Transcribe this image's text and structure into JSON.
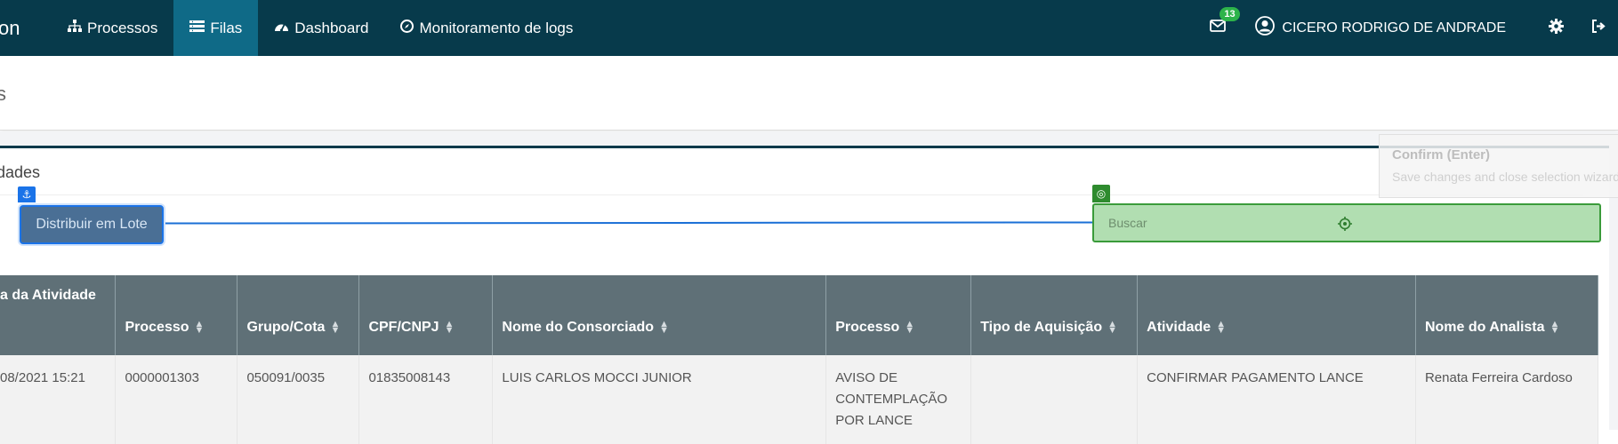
{
  "navbar": {
    "brand": "on",
    "items": [
      {
        "label": "Processos",
        "icon": "sitemap-icon",
        "active": false
      },
      {
        "label": "Filas",
        "icon": "list-icon",
        "active": true
      },
      {
        "label": "Dashboard",
        "icon": "gauge-icon",
        "active": false
      },
      {
        "label": "Monitoramento de logs",
        "icon": "compass-icon",
        "active": false
      }
    ],
    "mail_count": "13",
    "user_name": "CICERO RODRIGO DE ANDRADE"
  },
  "subheader": {
    "cut_text": "s"
  },
  "card": {
    "title": "dades",
    "batch_button": "Distribuir em Lote",
    "search_placeholder": "Buscar"
  },
  "tooltip": {
    "title": "Confirm (Enter)",
    "subtitle": "Save changes and close selection wizard"
  },
  "table": {
    "headers": [
      "a da Atividade",
      "Processo",
      "Grupo/Cota",
      "CPF/CNPJ",
      "Nome do Consorciado",
      "Processo",
      "Tipo de Aquisição",
      "Atividade",
      "Nome do Analista"
    ],
    "rows": [
      [
        "08/2021 15:21",
        "0000001303",
        "050091/0035",
        "01835008143",
        "LUIS CARLOS MOCCI JUNIOR",
        "AVISO DE\nCONTEMPLAÇÃO\nPOR LANCE",
        "",
        "CONFIRMAR PAGAMENTO LANCE",
        "Renata Ferreira Cardoso"
      ]
    ]
  }
}
